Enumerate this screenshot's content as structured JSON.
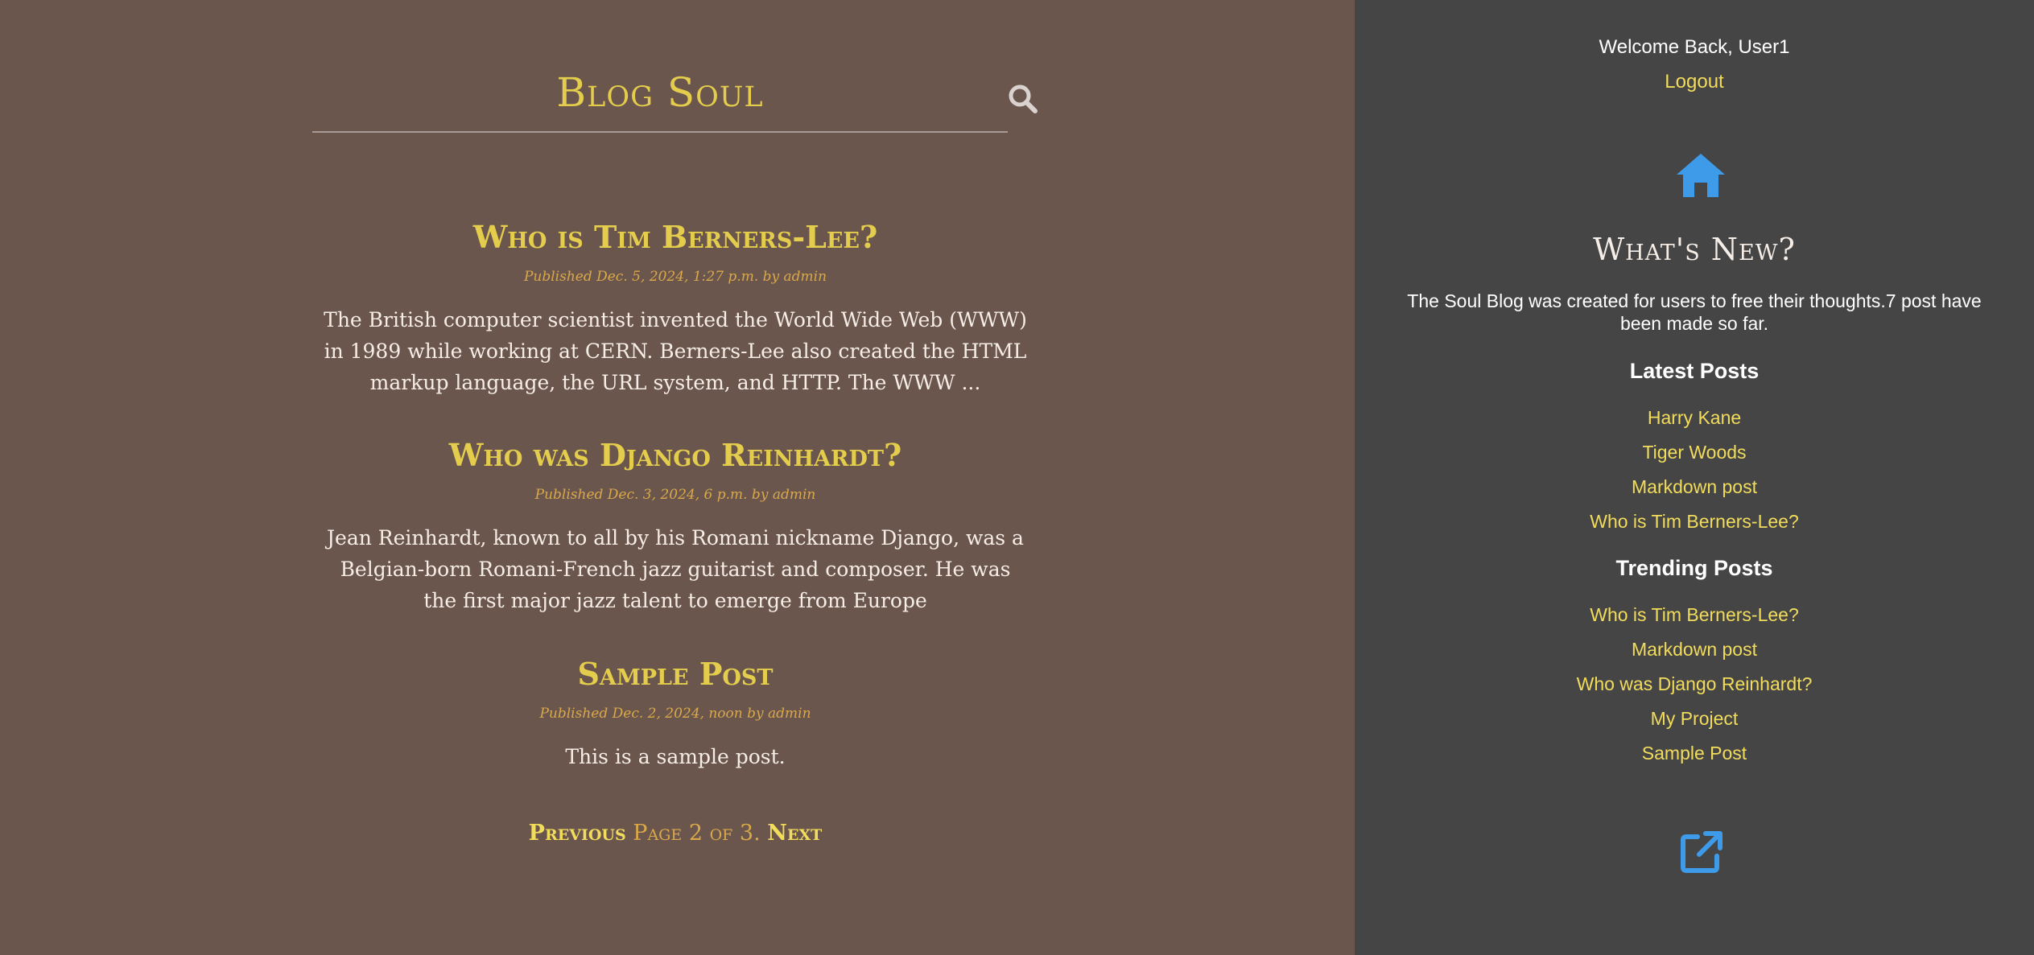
{
  "header": {
    "site_title": "Blog Soul",
    "search_icon": "search-icon"
  },
  "posts": [
    {
      "title": "Who is Tim Berners-Lee?",
      "meta": "Published Dec. 5, 2024, 1:27 p.m. by admin",
      "excerpt": "The British computer scientist invented the World Wide Web (WWW) in 1989 while working at CERN. Berners-Lee also created the HTML markup language, the URL system, and HTTP. The WWW ..."
    },
    {
      "title": "Who was Django Reinhardt?",
      "meta": "Published Dec. 3, 2024, 6 p.m. by admin",
      "excerpt": "Jean Reinhardt, known to all by his Romani nickname Django, was a Belgian-born Romani-French jazz guitarist and composer. He was the first major jazz talent to emerge from Europe"
    },
    {
      "title": "Sample Post",
      "meta": "Published Dec. 2, 2024, noon by admin",
      "excerpt": "This is a sample post."
    }
  ],
  "pagination": {
    "previous": "Previous",
    "current": "Page 2 of 3.",
    "next": "Next"
  },
  "sidebar": {
    "welcome": "Welcome Back, User1",
    "logout": "Logout",
    "home_icon": "home-icon",
    "whats_new": "What's New?",
    "about": "The Soul Blog was created for users to free their thoughts.7 post have been made so far.",
    "latest_heading": "Latest Posts",
    "latest": [
      "Harry Kane",
      "Tiger Woods",
      "Markdown post",
      "Who is Tim Berners-Lee?"
    ],
    "trending_heading": "Trending Posts",
    "trending": [
      "Who is Tim Berners-Lee?",
      "Markdown post",
      "Who was Django Reinhardt?",
      "My Project",
      "Sample Post"
    ],
    "external_icon": "external-link-icon"
  },
  "colors": {
    "main_bg": "#6b564e",
    "sidebar_bg": "#454545",
    "accent_gold": "#e4cd4c",
    "meta_orange": "#d9a84a",
    "icon_blue": "#3d9be9"
  }
}
